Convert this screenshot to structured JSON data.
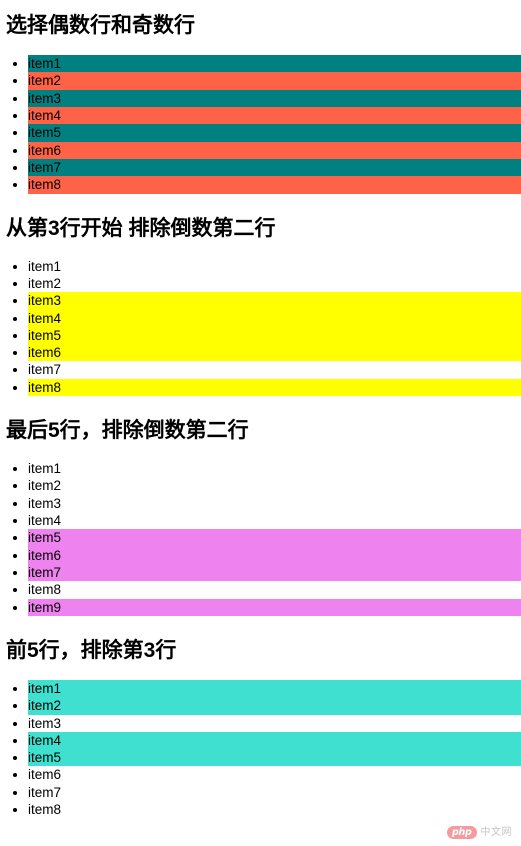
{
  "page": {
    "background": "#ffffff",
    "text_color": "#000000"
  },
  "sections": [
    {
      "title": "选择偶数行和奇数行",
      "highlight_colors": {
        "odd": "#008080",
        "even": "#FF6347"
      },
      "items": [
        {
          "label": "item1",
          "highlight": "#008080"
        },
        {
          "label": "item2",
          "highlight": "#FF6347"
        },
        {
          "label": "item3",
          "highlight": "#008080"
        },
        {
          "label": "item4",
          "highlight": "#FF6347"
        },
        {
          "label": "item5",
          "highlight": "#008080"
        },
        {
          "label": "item6",
          "highlight": "#FF6347"
        },
        {
          "label": "item7",
          "highlight": "#008080"
        },
        {
          "label": "item8",
          "highlight": "#FF6347"
        }
      ]
    },
    {
      "title": "从第3行开始 排除倒数第二行",
      "highlight_colors": {
        "primary": "#FFFF00"
      },
      "items": [
        {
          "label": "item1",
          "highlight": ""
        },
        {
          "label": "item2",
          "highlight": ""
        },
        {
          "label": "item3",
          "highlight": "#FFFF00"
        },
        {
          "label": "item4",
          "highlight": "#FFFF00"
        },
        {
          "label": "item5",
          "highlight": "#FFFF00"
        },
        {
          "label": "item6",
          "highlight": "#FFFF00"
        },
        {
          "label": "item7",
          "highlight": ""
        },
        {
          "label": "item8",
          "highlight": "#FFFF00"
        }
      ]
    },
    {
      "title": "最后5行，排除倒数第二行",
      "highlight_colors": {
        "primary": "#EE82EE"
      },
      "items": [
        {
          "label": "item1",
          "highlight": ""
        },
        {
          "label": "item2",
          "highlight": ""
        },
        {
          "label": "item3",
          "highlight": ""
        },
        {
          "label": "item4",
          "highlight": ""
        },
        {
          "label": "item5",
          "highlight": "#EE82EE"
        },
        {
          "label": "item6",
          "highlight": "#EE82EE"
        },
        {
          "label": "item7",
          "highlight": "#EE82EE"
        },
        {
          "label": "item8",
          "highlight": ""
        },
        {
          "label": "item9",
          "highlight": "#EE82EE"
        }
      ]
    },
    {
      "title": "前5行，排除第3行",
      "highlight_colors": {
        "primary": "#40E0D0"
      },
      "items": [
        {
          "label": "item1",
          "highlight": "#40E0D0"
        },
        {
          "label": "item2",
          "highlight": "#40E0D0"
        },
        {
          "label": "item3",
          "highlight": ""
        },
        {
          "label": "item4",
          "highlight": "#40E0D0"
        },
        {
          "label": "item5",
          "highlight": "#40E0D0"
        },
        {
          "label": "item6",
          "highlight": ""
        },
        {
          "label": "item7",
          "highlight": ""
        },
        {
          "label": "item8",
          "highlight": ""
        }
      ]
    }
  ],
  "watermark": {
    "badge_text": "php",
    "site_text": "中文网",
    "badge_color": "#f2868a",
    "site_text_color": "#b9b9b9"
  }
}
